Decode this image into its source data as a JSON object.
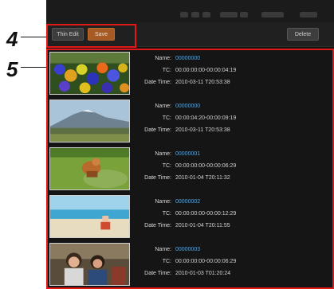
{
  "callouts": [
    {
      "number": "4"
    },
    {
      "number": "5"
    }
  ],
  "toolbar": {
    "left_button": "Thin Edit",
    "orange_button": "Save",
    "right_button": "Delete"
  },
  "labels": {
    "name": "Name:",
    "tc": "TC:",
    "date_time": "Date Time:"
  },
  "clips": [
    {
      "name": "00000000",
      "tc": "00:00:00:00-00:00:04:19",
      "date_time": "2010-03-11 T20:53:38",
      "thumb": "flowers"
    },
    {
      "name": "00000000",
      "tc": "00:00:04:20-00:00:09:19",
      "date_time": "2010-03-11 T20:53:38",
      "thumb": "mountain"
    },
    {
      "name": "00000001",
      "tc": "00:00:00:00-00:00:06:29",
      "date_time": "2010-01-04 T20:11:32",
      "thumb": "pond"
    },
    {
      "name": "00000002",
      "tc": "00:00:00:00-00:00:12:29",
      "date_time": "2010-01-04 T20:11:55",
      "thumb": "beach"
    },
    {
      "name": "00000003",
      "tc": "00:00:00:00-00:00:06:29",
      "date_time": "2010-01-03 T01:20:24",
      "thumb": "people"
    }
  ]
}
